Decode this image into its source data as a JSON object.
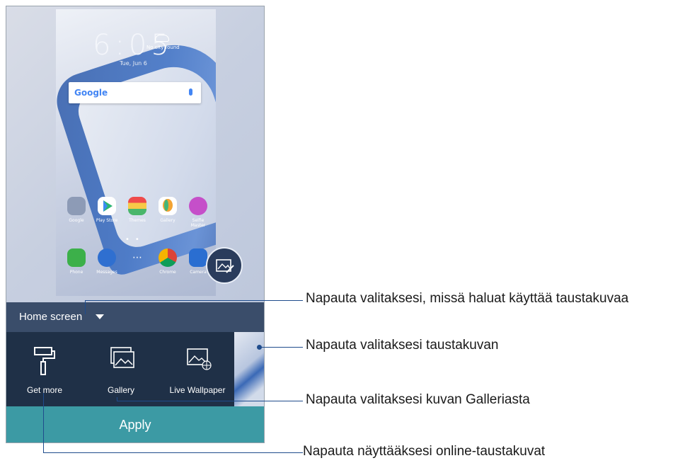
{
  "lockscreen": {
    "time": "6:05",
    "weather": "No city found",
    "date": "Tue, Jun 6",
    "search_brand": "Google"
  },
  "home_apps": [
    {
      "label": "Google",
      "color": "#8d9bb6",
      "icon": "folder-icon"
    },
    {
      "label": "Play Store",
      "color": "#ffffff",
      "icon": "play-store-icon"
    },
    {
      "label": "Themes",
      "color": "#f2c14a",
      "icon": "themes-icon"
    },
    {
      "label": "Gallery",
      "color": "#ffffff",
      "icon": "gallery-icon"
    },
    {
      "label": "Selfie Master",
      "color": "#c54fc9",
      "icon": "selfie-master-icon"
    }
  ],
  "dock_apps": [
    {
      "label": "Phone",
      "color": "#3cb04a",
      "icon": "phone-icon"
    },
    {
      "label": "Messages",
      "color": "#2f6fd0",
      "icon": "messages-icon"
    },
    {
      "label": "",
      "color": "transparent",
      "icon": "app-drawer-icon"
    },
    {
      "label": "Chrome",
      "color": "#ffffff",
      "icon": "chrome-icon"
    },
    {
      "label": "Camera",
      "color": "#2a6ed1",
      "icon": "camera-icon"
    }
  ],
  "mode_selector": {
    "label": "Home screen"
  },
  "tray": {
    "get_more": "Get more",
    "gallery": "Gallery",
    "live_wallpaper": "Live Wallpaper"
  },
  "apply_label": "Apply",
  "callouts": {
    "mode": "Napauta valitaksesi, missä haluat käyttää taustakuvaa",
    "wallpaper": "Napauta valitaksesi taustakuvan",
    "gallery": "Napauta valitaksesi kuvan Galleriasta",
    "online": "Napauta näyttääksesi online-taustakuvat"
  },
  "colors": {
    "accent": "#3c9aa4",
    "tray": "#1f3047",
    "mode_bar": "#3a4d6a",
    "callout_line": "#1f4c8c"
  }
}
